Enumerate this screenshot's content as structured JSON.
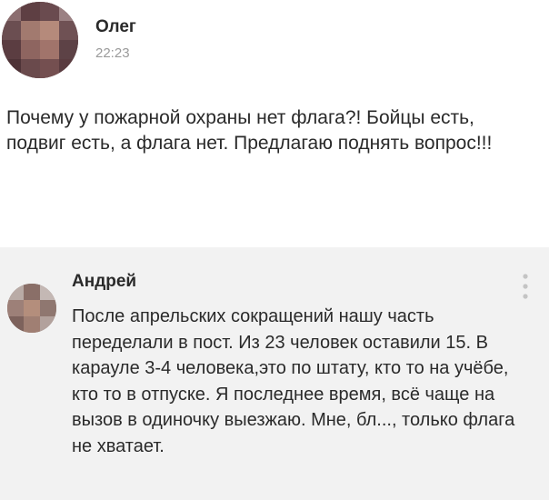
{
  "post": {
    "author": "Олег",
    "time": "22:23",
    "text": "Почему у пожарной охраны нет флага?! Бойцы есть, подвиг есть, а флага нет. Предлагаю поднять вопрос!!!"
  },
  "comment": {
    "author": "Андрей",
    "text": "После апрельских сокращений нашу часть переделали в пост. Из 23 человек оставили 15. В карауле 3-4 человека,это по штату, кто то на учёбе, кто то в отпуске. Я последнее время, всё чаще на вызов в одиночку выезжаю. Мне, бл..., только флага не хватает."
  },
  "icons": {
    "more": "vertical-dots-icon"
  },
  "colors": {
    "post_background": "#ffffff",
    "comment_background": "#f2f2f2",
    "time_text": "#9a9a9a",
    "main_text": "#2a2a2a"
  }
}
